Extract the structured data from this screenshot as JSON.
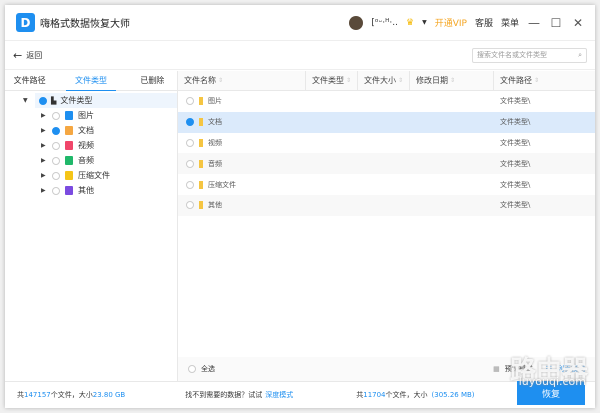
{
  "title": "嗨格式数据恢复大师",
  "user": {
    "name": "[ᵒᵕ·ᴴ·..",
    "vip": "开通VIP",
    "service": "客服",
    "menu": "菜单"
  },
  "back": "返回",
  "search_placeholder": "搜索文件名或文件类型",
  "tabs": [
    "文件路径",
    "文件类型",
    "已删除"
  ],
  "tree": {
    "root": "文件类型",
    "children": [
      {
        "label": "图片",
        "color": "#1e8ff0",
        "checked": false
      },
      {
        "label": "文档",
        "color": "#f5a742",
        "checked": true
      },
      {
        "label": "视频",
        "color": "#f0466a",
        "checked": false
      },
      {
        "label": "音频",
        "color": "#20b86a",
        "checked": false
      },
      {
        "label": "压缩文件",
        "color": "#f5c518",
        "checked": false
      },
      {
        "label": "其他",
        "color": "#7b4be0",
        "checked": false
      }
    ]
  },
  "columns": [
    "文件名称",
    "文件类型",
    "文件大小",
    "修改日期",
    "文件路径"
  ],
  "rows": [
    {
      "name": "图片",
      "path": "文件类型\\"
    },
    {
      "name": "文档",
      "path": "文件类型\\"
    },
    {
      "name": "视频",
      "path": "文件类型\\"
    },
    {
      "name": "音频",
      "path": "文件类型\\"
    },
    {
      "name": "压缩文件",
      "path": "文件类型\\"
    },
    {
      "name": "其他",
      "path": "文件类型\\"
    }
  ],
  "select_all": "全选",
  "view_modes": [
    "预览模式",
    "列表模式"
  ],
  "footer": {
    "prefix": "共",
    "total_files": "147157",
    "mid": "个文件，大小",
    "total_size": "23.80 GB",
    "hint": "找不到需要的数据？试试",
    "deep_mode": "深度模式",
    "sel_prefix": "共",
    "sel_files": "11704",
    "sel_mid": "个文件，大小",
    "sel_size": "(305.26 MB)"
  },
  "recover": "恢复",
  "watermark": {
    "text": "路由器",
    "url": "luyouqi.com"
  }
}
